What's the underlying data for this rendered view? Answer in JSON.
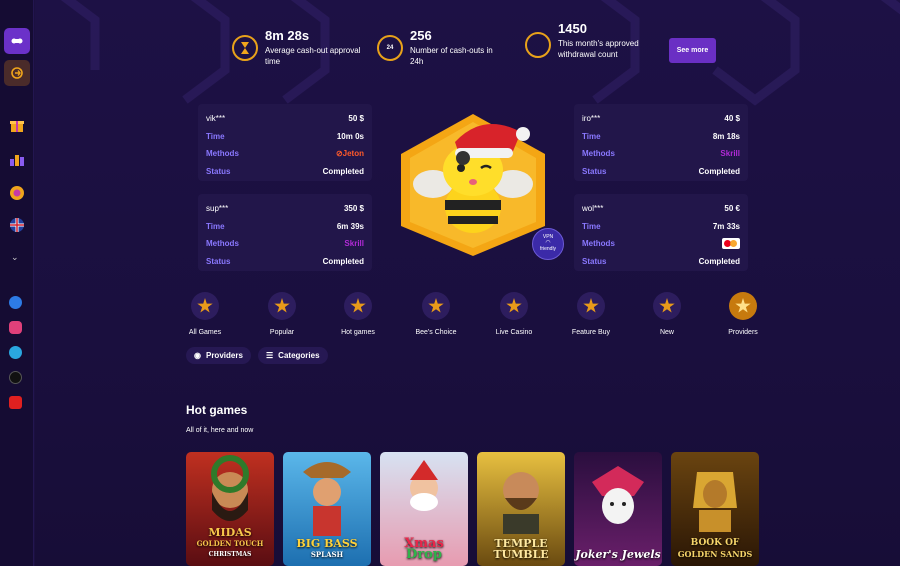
{
  "stats": [
    {
      "value": "8m 28s",
      "label": "Average cash-out approval time"
    },
    {
      "value": "256",
      "label": "Number of cash-outs in 24h",
      "icon_text": "24"
    },
    {
      "value": "1450",
      "label": "This month's approved withdrawal count"
    }
  ],
  "see_more": "See more",
  "row_labels": {
    "time": "Time",
    "methods": "Methods",
    "status": "Status"
  },
  "cashouts": [
    {
      "user": "vik***",
      "amount": "50 $",
      "time": "10m 0s",
      "method": "Jeton",
      "method_icon": "jeton-icon",
      "status": "Completed"
    },
    {
      "user": "sup***",
      "amount": "350 $",
      "time": "6m 39s",
      "method": "Skrill",
      "method_icon": "skrill-icon",
      "status": "Completed"
    },
    {
      "user": "iro***",
      "amount": "40 $",
      "time": "8m 18s",
      "method": "Skrill",
      "method_icon": "skrill-icon",
      "status": "Completed"
    },
    {
      "user": "wol***",
      "amount": "50 €",
      "time": "7m 33s",
      "method": "",
      "method_icon": "mastercard-icon",
      "status": "Completed"
    }
  ],
  "vpn_badge": {
    "line1": "VPN",
    "line2": "friendly"
  },
  "categories": [
    "All Games",
    "Popular",
    "Hot games",
    "Bee's Choice",
    "Live Casino",
    "Feature Buy",
    "New",
    "Providers"
  ],
  "filters": {
    "providers": "Providers",
    "categories": "Categories"
  },
  "section": {
    "title": "Hot games",
    "subtitle": "All of it, here and now"
  },
  "games": [
    {
      "title": "MIDAS",
      "sub": "GOLDEN TOUCH",
      "sub2": "CHRISTMAS",
      "bg": "#7a1a1a"
    },
    {
      "title": "BIG BASS",
      "sub": "SPLASH",
      "sub2": "",
      "bg": "#2a8fd0"
    },
    {
      "title": "Xmas",
      "sub": "Drop",
      "sub2": "",
      "bg": "#c8d4e8"
    },
    {
      "title": "TEMPLE",
      "sub": "TUMBLE",
      "sub2": "",
      "bg": "#c9a326"
    },
    {
      "title": "Joker's",
      "sub": "Jewels",
      "sub2": "",
      "bg": "#5a1f6e"
    },
    {
      "title": "BOOK OF",
      "sub": "GOLDEN SANDS",
      "sub2": "",
      "bg": "#3a2208"
    }
  ],
  "colors": {
    "accent": "#6a2fc4",
    "gold": "#f0a51c",
    "label": "#8a78ff"
  }
}
